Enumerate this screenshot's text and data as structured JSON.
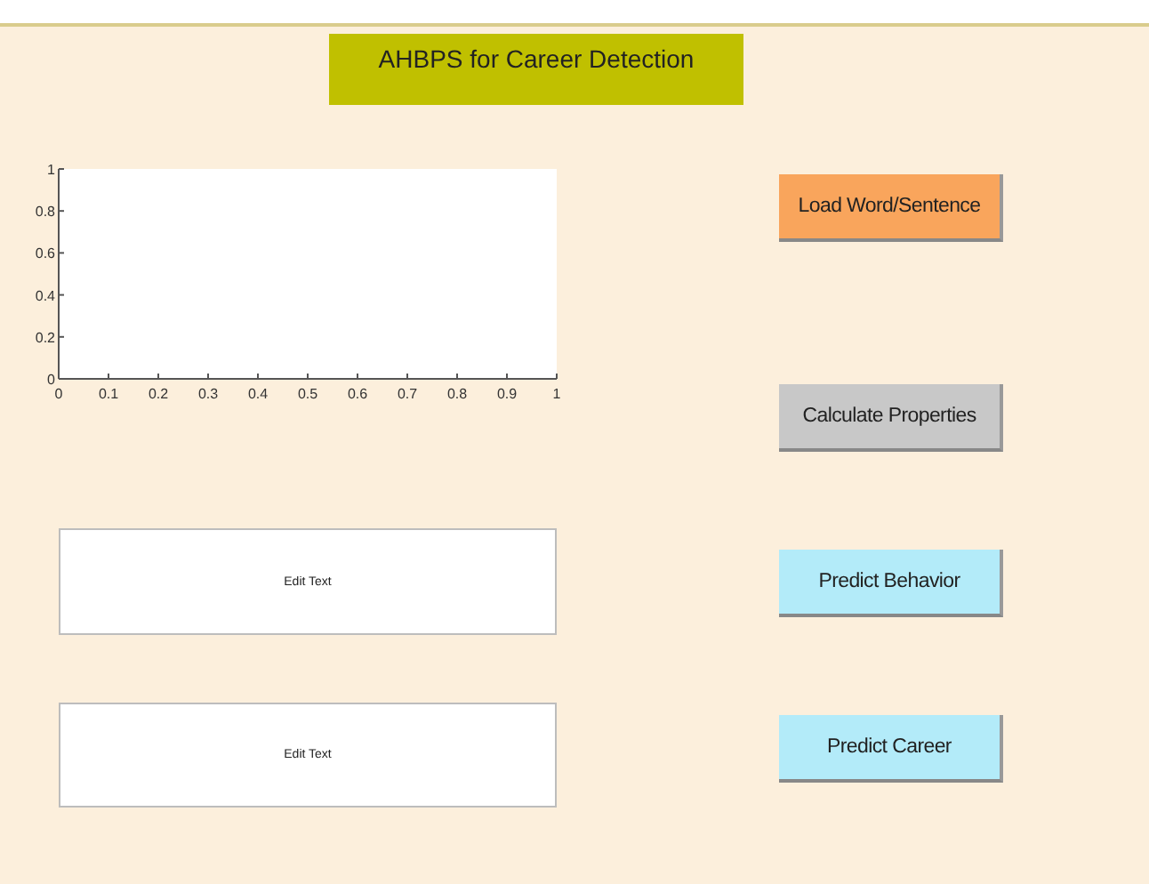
{
  "title": "AHBPS for Career Detection",
  "axes": {
    "chart_data": {
      "type": "line",
      "xlim": [
        0,
        1
      ],
      "ylim": [
        0,
        1
      ],
      "xticks": [
        0,
        0.1,
        0.2,
        0.3,
        0.4,
        0.5,
        0.6,
        0.7,
        0.8,
        0.9,
        1
      ],
      "yticks": [
        0,
        0.2,
        0.4,
        0.6,
        0.8,
        1
      ]
    }
  },
  "edit_fields": [
    {
      "value": "Edit Text"
    },
    {
      "value": "Edit Text"
    }
  ],
  "buttons": [
    {
      "label": "Load Word/Sentence",
      "color": "#f9a55c"
    },
    {
      "label": "Calculate Properties",
      "color": "#c8c8c8"
    },
    {
      "label": "Predict Behavior",
      "color": "#b3ebf9"
    },
    {
      "label": "Predict Career",
      "color": "#b3ebf9"
    }
  ]
}
